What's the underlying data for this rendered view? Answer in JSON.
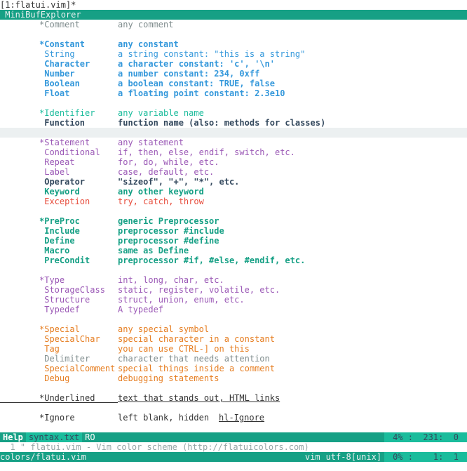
{
  "tabline": "[1:flatui.vim]*",
  "minibuf_label": " MiniBufExplorer",
  "entries": [
    {
      "kind": "group",
      "name": "*Comment",
      "desc": "any comment",
      "cls": "c-grey"
    },
    {
      "kind": "blank"
    },
    {
      "kind": "group",
      "name": "*Constant",
      "desc": "any constant",
      "cls": "c-blue bold"
    },
    {
      "kind": "item",
      "name": " String",
      "desc": "a string constant: \"this is a string\"",
      "cls": "c-blue"
    },
    {
      "kind": "item",
      "name": " Character",
      "desc": "a character constant: 'c', '\\n'",
      "cls": "c-blue bold"
    },
    {
      "kind": "item",
      "name": " Number",
      "desc": "a number constant: 234, 0xff",
      "cls": "c-blue bold"
    },
    {
      "kind": "item",
      "name": " Boolean",
      "desc": "a boolean constant: TRUE, false",
      "cls": "c-blue bold"
    },
    {
      "kind": "item",
      "name": " Float",
      "desc": "a floating point constant: 2.3e10",
      "cls": "c-blue bold"
    },
    {
      "kind": "blank"
    },
    {
      "kind": "group",
      "name": "*Identifier",
      "desc": "any variable name",
      "cls": "c-green"
    },
    {
      "kind": "item",
      "name": " Function",
      "desc": "function name (also: methods for classes)",
      "cls": "c-dark"
    },
    {
      "kind": "cursor"
    },
    {
      "kind": "group",
      "name": "*Statement",
      "desc": "any statement",
      "cls": "c-purple"
    },
    {
      "kind": "item",
      "name": " Conditional",
      "desc": "if, then, else, endif, switch, etc.",
      "cls": "c-purple"
    },
    {
      "kind": "item",
      "name": " Repeat",
      "desc": "for, do, while, etc.",
      "cls": "c-purple"
    },
    {
      "kind": "item",
      "name": " Label",
      "desc": "case, default, etc.",
      "cls": "c-purple"
    },
    {
      "kind": "item",
      "name": " Operator",
      "desc": "\"sizeof\", \"+\", \"*\", etc.",
      "cls": "c-dark"
    },
    {
      "kind": "item",
      "name": " Keyword",
      "desc": "any other keyword",
      "cls": "c-darkgreen"
    },
    {
      "kind": "item",
      "name": " Exception",
      "desc": "try, catch, throw",
      "cls": "c-red"
    },
    {
      "kind": "blank"
    },
    {
      "kind": "group",
      "name": "*PreProc",
      "desc": "generic Preprocessor",
      "cls": "c-darkgreen"
    },
    {
      "kind": "item",
      "name": " Include",
      "desc": "preprocessor #include",
      "cls": "c-darkgreen"
    },
    {
      "kind": "item",
      "name": " Define",
      "desc": "preprocessor #define",
      "cls": "c-darkgreen"
    },
    {
      "kind": "item",
      "name": " Macro",
      "desc": "same as Define",
      "cls": "c-darkgreen"
    },
    {
      "kind": "item",
      "name": " PreCondit",
      "desc": "preprocessor #if, #else, #endif, etc.",
      "cls": "c-darkgreen"
    },
    {
      "kind": "blank"
    },
    {
      "kind": "group",
      "name": "*Type",
      "desc": "int, long, char, etc.",
      "cls": "c-purple"
    },
    {
      "kind": "item",
      "name": " StorageClass",
      "desc": "static, register, volatile, etc.",
      "cls": "c-purple"
    },
    {
      "kind": "item",
      "name": " Structure",
      "desc": "struct, union, enum, etc.",
      "cls": "c-purple"
    },
    {
      "kind": "item",
      "name": " Typedef",
      "desc": "A typedef",
      "cls": "c-purple"
    },
    {
      "kind": "blank"
    },
    {
      "kind": "group",
      "name": "*Special",
      "desc": "any special symbol",
      "cls": "c-orange"
    },
    {
      "kind": "item",
      "name": " SpecialChar",
      "desc": "special character in a constant",
      "cls": "c-orange"
    },
    {
      "kind": "item",
      "name": " Tag",
      "desc": "you can use CTRL-] on this",
      "cls": "c-orange"
    },
    {
      "kind": "item",
      "name": " Delimiter",
      "desc": "character that needs attention",
      "cls": "c-grey"
    },
    {
      "kind": "item",
      "name": " SpecialComment",
      "desc": "special things inside a comment",
      "cls": "c-orange"
    },
    {
      "kind": "item",
      "name": " Debug",
      "desc": "debugging statements",
      "cls": "c-orange"
    },
    {
      "kind": "blank"
    },
    {
      "kind": "underlined",
      "name": "*Underlined",
      "desc": "text that stands out, HTML links",
      "cls": ""
    },
    {
      "kind": "blank"
    },
    {
      "kind": "ignore",
      "name": "*Ignore",
      "desc": "left blank, hidden  ",
      "link": "hl-Ignore",
      "cls": ""
    },
    {
      "kind": "blank"
    }
  ],
  "help_status": {
    "help": "Help",
    "file": "syntax.txt",
    "ro": "RO",
    "percent": "4%",
    "position": ":  231:  0"
  },
  "command_line": "  1 \" flatui.vim - Vim color scheme (http://flatuicolors.com)",
  "bottom_status": {
    "file": "colors/flatui.vim",
    "filetype": "vim",
    "encoding": "utf-8[unix]",
    "percent": "0%",
    "position": ":    1:  1"
  },
  "colors": {
    "accent": "#16a085",
    "accent_light": "#1abc9c"
  }
}
